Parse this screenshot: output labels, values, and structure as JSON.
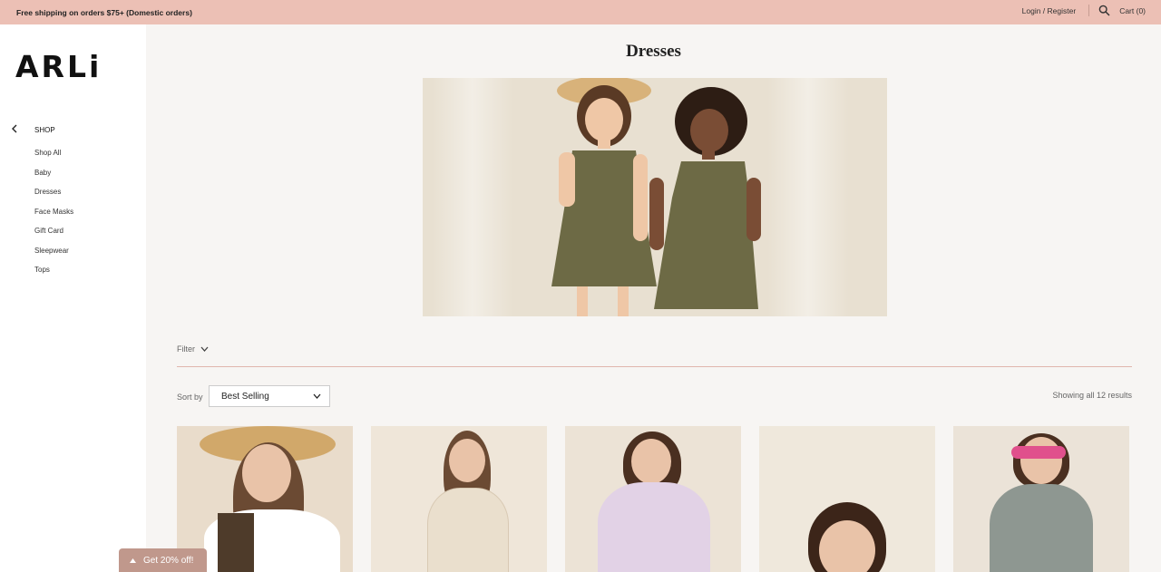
{
  "announcement": {
    "text": "Free shipping on orders $75+ (Domestic orders)"
  },
  "header": {
    "account_label": "Login / Register",
    "search_icon": "search-icon",
    "cart_label": "Cart (0)"
  },
  "brand": {
    "logo": "ARLi"
  },
  "sidebar": {
    "section_label": "SHOP",
    "back_icon": "chevron-left-icon",
    "items": [
      {
        "label": "Shop All"
      },
      {
        "label": "Baby"
      },
      {
        "label": "Dresses"
      },
      {
        "label": "Face Masks"
      },
      {
        "label": "Gift Card"
      },
      {
        "label": "Sleepwear"
      },
      {
        "label": "Tops"
      }
    ]
  },
  "collection": {
    "title": "Dresses"
  },
  "toolbar": {
    "filter_label": "Filter",
    "sort_label": "Sort by",
    "sort_selected": "Best Selling",
    "results_text": "Showing all 12 results"
  },
  "promo": {
    "label": "Get 20% off!"
  },
  "colors": {
    "announcement_bg": "#ecc0b5",
    "page_bg": "#f7f5f3",
    "divider": "#e1b6ad",
    "promo_tab": "#c0988c"
  }
}
